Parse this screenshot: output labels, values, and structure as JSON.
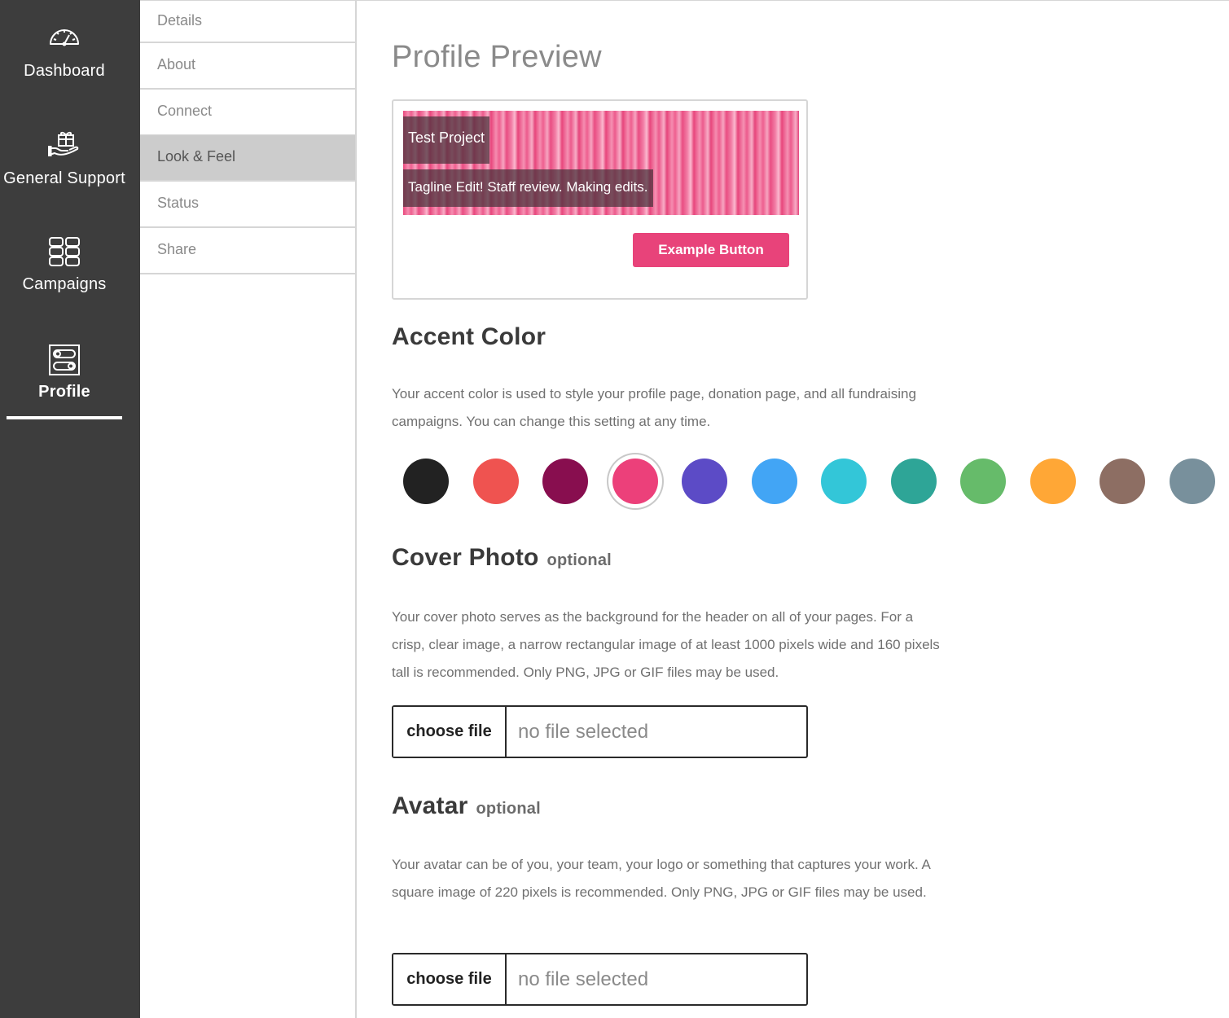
{
  "nav": {
    "items": [
      {
        "label": "Dashboard",
        "icon": "speedometer-icon"
      },
      {
        "label": "General Support",
        "icon": "gift-hand-icon"
      },
      {
        "label": "Campaigns",
        "icon": "grid-icon"
      },
      {
        "label": "Profile",
        "icon": "toggles-icon",
        "active": true
      }
    ]
  },
  "subnav": {
    "items": [
      {
        "label": "Details"
      },
      {
        "label": "About"
      },
      {
        "label": "Connect"
      },
      {
        "label": "Look & Feel",
        "active": true
      },
      {
        "label": "Status"
      },
      {
        "label": "Share"
      }
    ]
  },
  "main": {
    "title": "Profile Preview",
    "preview": {
      "project_title": "Test Project",
      "tagline": "Tagline Edit! Staff review. Making edits.",
      "button_label": "Example Button"
    },
    "accent": {
      "title": "Accent Color",
      "description": "Your accent color is used to style your profile page, donation page, and all fundraising campaigns. You can change this setting at any time.",
      "colors": [
        "#222222",
        "#ef5350",
        "#880e4f",
        "#ec407a",
        "#5c4bc6",
        "#42a5f5",
        "#33c6d8",
        "#2ea597",
        "#66bb6a",
        "#ffa736",
        "#8d6e63",
        "#78909c"
      ],
      "selected_color": "#ec407a"
    },
    "cover": {
      "title": "Cover Photo",
      "optional": "optional",
      "description": "Your cover photo serves as the background for the header on all of your pages. For a crisp, clear image, a narrow rectangular image of at least 1000 pixels wide and 160 pixels tall is recommended. Only PNG, JPG or GIF files may be used.",
      "button_label": "choose file",
      "file_status": "no file selected"
    },
    "avatar": {
      "title": "Avatar",
      "optional": "optional",
      "description": "Your avatar can be of you, your team, your logo or something that captures your work. A square image of 220 pixels is recommended. Only PNG, JPG or GIF files may be used.",
      "button_label": "choose file",
      "file_status": "no file selected"
    }
  }
}
